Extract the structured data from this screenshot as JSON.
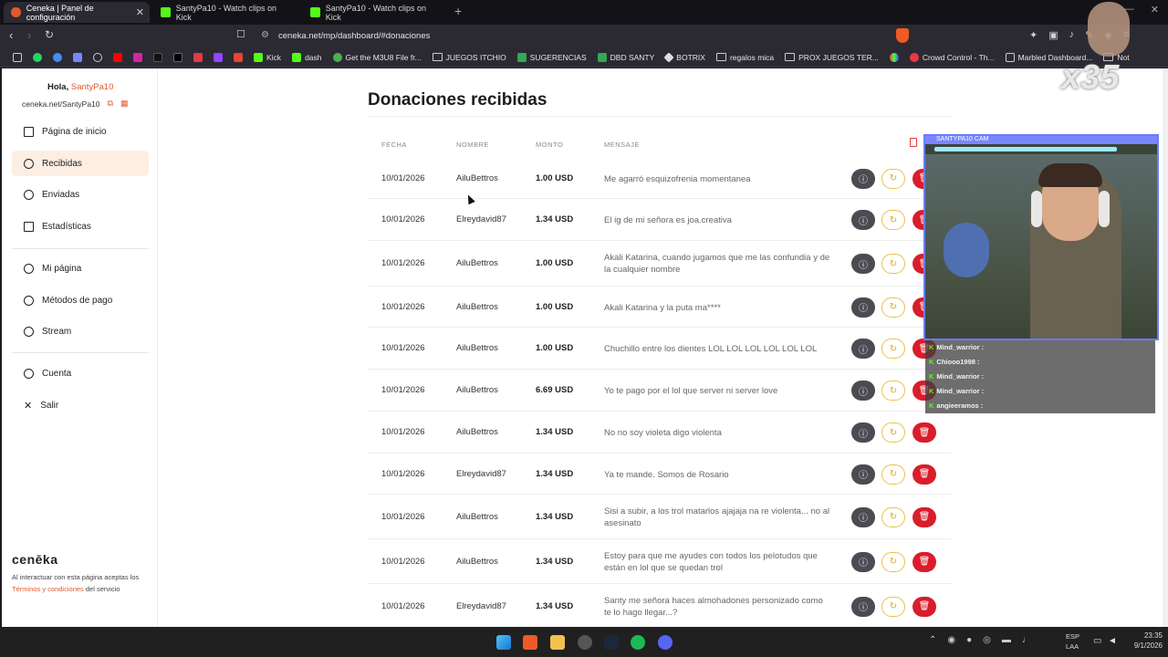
{
  "browser": {
    "tabs": [
      {
        "label": "Ceneka | Panel de configuración",
        "active": true
      },
      {
        "label": "SantyPa10 - Watch clips on Kick",
        "active": false
      },
      {
        "label": "SantyPa10 - Watch clips on Kick",
        "active": false
      }
    ],
    "url": "ceneka.net/mp/dashboard/#donaciones",
    "bookmarks": [
      "Kick",
      "dash",
      "Get the M3U8 File fr...",
      "JUEGOS ITCHIO",
      "SUGERENCIAS",
      "DBD SANTY",
      "BOTRIX",
      "regalos mica",
      "PROX JUEGOS TER...",
      "Crowd Control - Th...",
      "Marbled Dashboard...",
      "Not"
    ]
  },
  "sidebar": {
    "greeting": "Hola,",
    "username": "SantyPa10",
    "user_url": "ceneka.net/SantyPa10",
    "items": [
      {
        "label": "Página de inicio",
        "icon": "home-icon"
      },
      {
        "label": "Recibidas",
        "icon": "arrow-down-circle-icon",
        "active": true
      },
      {
        "label": "Enviadas",
        "icon": "arrow-up-circle-icon"
      },
      {
        "label": "Estadísticas",
        "icon": "bar-chart-icon"
      },
      {
        "label": "Mi página",
        "icon": "gear-icon"
      },
      {
        "label": "Métodos de pago",
        "icon": "money-icon"
      },
      {
        "label": "Stream",
        "icon": "bell-icon"
      },
      {
        "label": "Cuenta",
        "icon": "user-icon"
      },
      {
        "label": "Salir",
        "icon": "close-icon"
      }
    ],
    "brand": "cenēka",
    "legal_pre": "Al interactuar con esta página aceptas los",
    "legal_link": "Términos y condiciones",
    "legal_post": "del servicio"
  },
  "main": {
    "title": "Donaciones recibidas",
    "columns": [
      "FECHA",
      "NOMBRE",
      "MONTO",
      "MENSAJE"
    ],
    "rows": [
      {
        "fecha": "10/01/2026",
        "nombre": "AiluBettros",
        "monto": "1.00 USD",
        "mensaje": "Me agarró esquizofrenia momentanea"
      },
      {
        "fecha": "10/01/2026",
        "nombre": "Elreydavid87",
        "monto": "1.34 USD",
        "mensaje": "El ig de mi señora es joa.creativa"
      },
      {
        "fecha": "10/01/2026",
        "nombre": "AiluBettros",
        "monto": "1.00 USD",
        "mensaje": "Akali Katarina, cuando jugamos que me las confundia y de la cualquier nombre"
      },
      {
        "fecha": "10/01/2026",
        "nombre": "AiluBettros",
        "monto": "1.00 USD",
        "mensaje": "Akali Katarina y la puta ma****"
      },
      {
        "fecha": "10/01/2026",
        "nombre": "AiluBettros",
        "monto": "1.00 USD",
        "mensaje": "Chuchillo entre los dientes LOL LOL LOL LOL LOL LOL"
      },
      {
        "fecha": "10/01/2026",
        "nombre": "AiluBettros",
        "monto": "6.69 USD",
        "mensaje": "Yo te pago por el lol que server ni server love"
      },
      {
        "fecha": "10/01/2026",
        "nombre": "AiluBettros",
        "monto": "1.34 USD",
        "mensaje": "No no soy violeta digo violenta"
      },
      {
        "fecha": "10/01/2026",
        "nombre": "Elreydavid87",
        "monto": "1.34 USD",
        "mensaje": "Ya te mande. Somos de Rosario"
      },
      {
        "fecha": "10/01/2026",
        "nombre": "AiluBettros",
        "monto": "1.34 USD",
        "mensaje": "Sisi a subir, a los trol matarlos ajajaja na re violenta... no al asesinato"
      },
      {
        "fecha": "10/01/2026",
        "nombre": "AiluBettros",
        "monto": "1.34 USD",
        "mensaje": "Estoy para que me ayudes con todos los pelotudos que están en lol que se quedan trol"
      },
      {
        "fecha": "10/01/2026",
        "nombre": "Elreydavid87",
        "monto": "1.34 USD",
        "mensaje": "Santy me señora haces almohadones personizado como te lo hago llegar...?"
      }
    ]
  },
  "overlay": {
    "cam_label": "SANTYPA10 CAM",
    "badge": "x35",
    "chat": [
      {
        "user": "Mind_warrior :"
      },
      {
        "user": "Chiooo1998 :"
      },
      {
        "user": "Mind_warrior :"
      },
      {
        "user": "Mind_warrior :"
      },
      {
        "user": "angieeramos :"
      }
    ]
  },
  "taskbar": {
    "lang1": "ESP",
    "lang2": "LAA",
    "time": "23:35",
    "date": "9/1/2026"
  },
  "colors": {
    "accent": "#e4592c",
    "active_bg": "#fdeee3",
    "delete": "#d91d2a",
    "retry": "#e9c24a"
  }
}
